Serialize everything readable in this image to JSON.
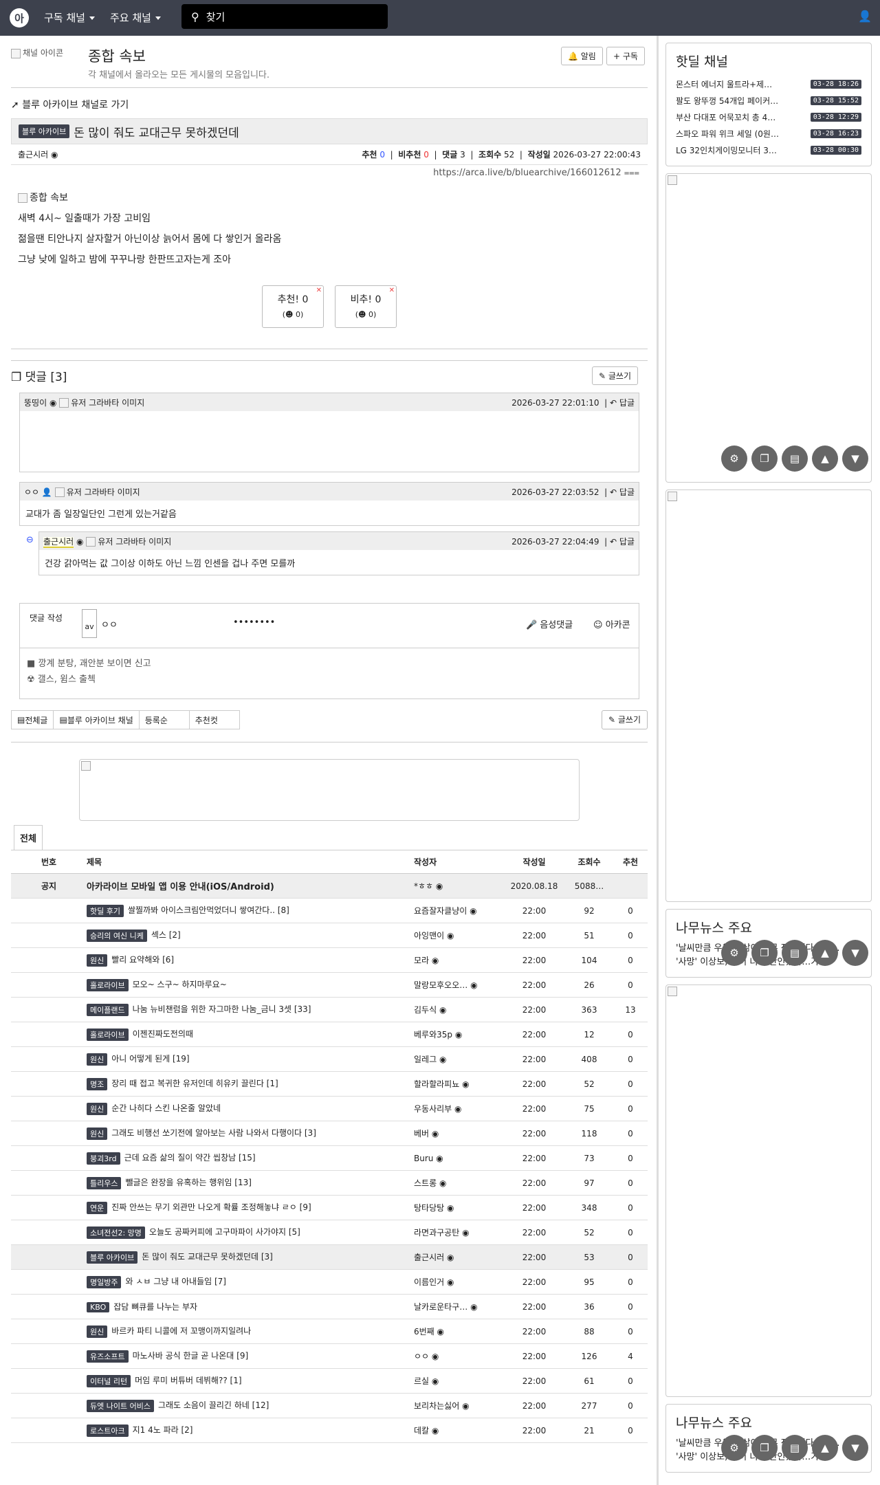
{
  "nav": {
    "logo": "아",
    "channels_menu": "구독 채널",
    "main_menu": "주요 채널",
    "search_placeholder": "찾기"
  },
  "channel": {
    "image_alt": "채널 아이콘",
    "title": "종합 속보",
    "description": "각 채널에서 올라오는 모든 게시물의 모음입니다.",
    "alarm_btn": "알림",
    "subscribe_btn": "+ 구독"
  },
  "article": {
    "back_link": "블루 아카이브 채널로 가기",
    "category": "블루 아카이브",
    "title": "돈 많이 줘도 교대근무 못하겠던데",
    "author": "출근시러",
    "upvote_label": "추천",
    "upvote": "0",
    "downvote_label": "비추천",
    "downvote": "0",
    "comments_label": "댓글",
    "comments": "3",
    "views_label": "조회수",
    "views": "52",
    "date_label": "작성일",
    "date": "2026-03-27 22:00:43",
    "url": "https://arca.live/b/bluearchive/166012612",
    "image_alt": "종합 속보",
    "lines": [
      "새벽 4시~ 일출때가 가장 고비임",
      "젊을땐 티안나지 살자할거 아닌이상 늙어서 몸에 다 쌓인거 올라옴",
      "그냥 낮에 일하고 밤에 꾸꾸나랑 한판뜨고자는게 조아"
    ],
    "vote_up": "추천! 0",
    "vote_up_sub": "(☻ 0)",
    "vote_down": "비추! 0",
    "vote_down_sub": "(☻ 0)"
  },
  "comments": {
    "header": "댓글 [3]",
    "write_btn": "글쓰기",
    "avatar_alt": "유저 그라바타 이미지",
    "reply": "답글",
    "items": [
      {
        "author": "뚱띵이",
        "date": "2026-03-27 22:01:10",
        "text": ""
      },
      {
        "author": "ㅇㅇ",
        "date": "2026-03-27 22:03:52",
        "text": "교대가 좀 일장일단인 그런게 있는거같음"
      },
      {
        "author": "출근시러",
        "date": "2026-03-27 22:04:49",
        "text": "건강 갉아먹는 값 그이상 이하도 아닌 느낌 인센을 겁나 주면 모를까"
      }
    ]
  },
  "comment_form": {
    "label": "댓글 작성",
    "avatar": "av",
    "name": "ㅇㅇ",
    "password": "••••••••",
    "voice": "음성댓글",
    "arcacon": "아카콘",
    "rule1": "깡계 분탕, 괘안분 보이면 신고",
    "rule2": "갤스, 윔스 출첵"
  },
  "list_tabs": {
    "all": "전체글",
    "channel": "블루 아카이브 채널",
    "sort": "등록순",
    "best": "추천컷",
    "write": "글쓰기",
    "tab_all": "전체"
  },
  "table": {
    "headers": [
      "번호",
      "제목",
      "작성자",
      "작성일",
      "조회수",
      "추천"
    ],
    "notice": {
      "num": "공지",
      "title": "아카라이브 모바일 앱 이용 안내(iOS/Android)",
      "author": "*ㅎㅎ",
      "date": "2020.08.18",
      "views": "5088…",
      "rec": ""
    },
    "rows": [
      {
        "badge": "핫딜 후기",
        "title": "쌀찔까봐 아이스크림안먹었더니 쌓여간다.. [8]",
        "author": "요즘잘자클냥이",
        "date": "22:00",
        "views": "92",
        "rec": "0"
      },
      {
        "badge": "승리의 여신 니케",
        "title": "섹스 [2]",
        "author": "아잉맨이",
        "date": "22:00",
        "views": "51",
        "rec": "0"
      },
      {
        "badge": "원신",
        "title": "빨리 요약해와 [6]",
        "author": "모라",
        "date": "22:00",
        "views": "104",
        "rec": "0"
      },
      {
        "badge": "홀로라이브",
        "title": "모오~ 스구~ 하지마루요~",
        "author": "말랑모후오오…",
        "date": "22:00",
        "views": "26",
        "rec": "0"
      },
      {
        "badge": "메이플랜드",
        "title": "나눔 뉴비챈럼을 위한 자그마한 나눔_금니 3셋 [33]",
        "author": "김두식",
        "date": "22:00",
        "views": "363",
        "rec": "13"
      },
      {
        "badge": "홀로라이브",
        "title": "이젠진짜도전의때",
        "author": "베루와35p",
        "date": "22:00",
        "views": "12",
        "rec": "0"
      },
      {
        "badge": "원신",
        "title": "아니 어떻게 된게 [19]",
        "author": "일레그",
        "date": "22:00",
        "views": "408",
        "rec": "0"
      },
      {
        "badge": "명조",
        "title": "장리 때 접고 복귀한 유저인데 히유키 끌린다 [1]",
        "author": "할라할라피뇨",
        "date": "22:00",
        "views": "52",
        "rec": "0"
      },
      {
        "badge": "원신",
        "title": "순간 나히다 스킨 나온줄 알았네",
        "author": "우동사리부",
        "date": "22:00",
        "views": "75",
        "rec": "0"
      },
      {
        "badge": "원신",
        "title": "그래도 비행선 쏘기전에 알아보는 사람 나와서 다행이다 [3]",
        "author": "베버",
        "date": "22:00",
        "views": "118",
        "rec": "0"
      },
      {
        "badge": "붕괴3rd",
        "title": "근데 요즘 삶의 질이 약간 씹창남 [15]",
        "author": "Buru",
        "date": "22:00",
        "views": "73",
        "rec": "0"
      },
      {
        "badge": "틀리우스",
        "title": "뺄글은 완장을 유혹하는 행위임 [13]",
        "author": "스트롱",
        "date": "22:00",
        "views": "97",
        "rec": "0"
      },
      {
        "badge": "연운",
        "title": "진짜 안쓰는 무기 외관만 나오게 확률 조정해놓냐 ㄹㅇ [9]",
        "author": "탕타당탕",
        "date": "22:00",
        "views": "348",
        "rec": "0"
      },
      {
        "badge": "소녀전선2: 망명",
        "title": "오늘도 공짜커피에 고구마파이 사가야지 [5]",
        "author": "라면과구공탄",
        "date": "22:00",
        "views": "52",
        "rec": "0"
      },
      {
        "badge": "블루 아카이브",
        "title": "돈 많이 줘도 교대근무 못하겠던데 [3]",
        "author": "출근시러",
        "date": "22:00",
        "views": "53",
        "rec": "0",
        "hl": true
      },
      {
        "badge": "명일방주",
        "title": "와 ㅅㅂ 그냥 내 아내들임 [7]",
        "author": "이름인거",
        "date": "22:00",
        "views": "95",
        "rec": "0"
      },
      {
        "badge": "KBO",
        "title": "잡담 뼈큐를 나누는 부자",
        "author": "날카로운타구…",
        "date": "22:00",
        "views": "36",
        "rec": "0"
      },
      {
        "badge": "원신",
        "title": "바르카 파티 니콜에 저 꼬맹이까지일려나",
        "author": "6번째",
        "date": "22:00",
        "views": "88",
        "rec": "0"
      },
      {
        "badge": "유즈소프트",
        "title": "마노사바 공식 한글 곧 나온대 [9]",
        "author": "ㅇㅇ",
        "date": "22:00",
        "views": "126",
        "rec": "4"
      },
      {
        "badge": "이터널 리턴",
        "title": "머임 루미 버튜버 데뷔해?? [1]",
        "author": "르실",
        "date": "22:00",
        "views": "61",
        "rec": "0"
      },
      {
        "badge": "듀엣 나이트 어비스",
        "title": "그래도 소음이 끌리긴 하네 [12]",
        "author": "보리차는싫어",
        "date": "22:00",
        "views": "277",
        "rec": "0"
      },
      {
        "badge": "로스트아크",
        "title": "지1 4노 파라 [2]",
        "author": "데칼",
        "date": "22:00",
        "views": "21",
        "rec": "0"
      }
    ]
  },
  "side": {
    "hotdeal_title": "핫딜 채널",
    "hotdeals": [
      {
        "t": "몬스터 에너지 울트라+제…",
        "d": "03-28 18:26"
      },
      {
        "t": "팔도 왕뚜껑 54개입 페이커…",
        "d": "03-28 15:52"
      },
      {
        "t": "부산 다대포 어묵꼬치 총 4…",
        "d": "03-28 12:29"
      },
      {
        "t": "스파오 파워 위크 세일 (0원…",
        "d": "03-28 16:23"
      },
      {
        "t": "LG 32인치게이밍모니터 3…",
        "d": "03-28 00:30"
      }
    ],
    "news_title": "나무뉴스 주요",
    "news_text": "'날씨만큼 우울… 삶이 너무 잔인했다…가…",
    "news_text2": "'사망' 이상보, 삶이 너무 잔인했다…가…"
  }
}
